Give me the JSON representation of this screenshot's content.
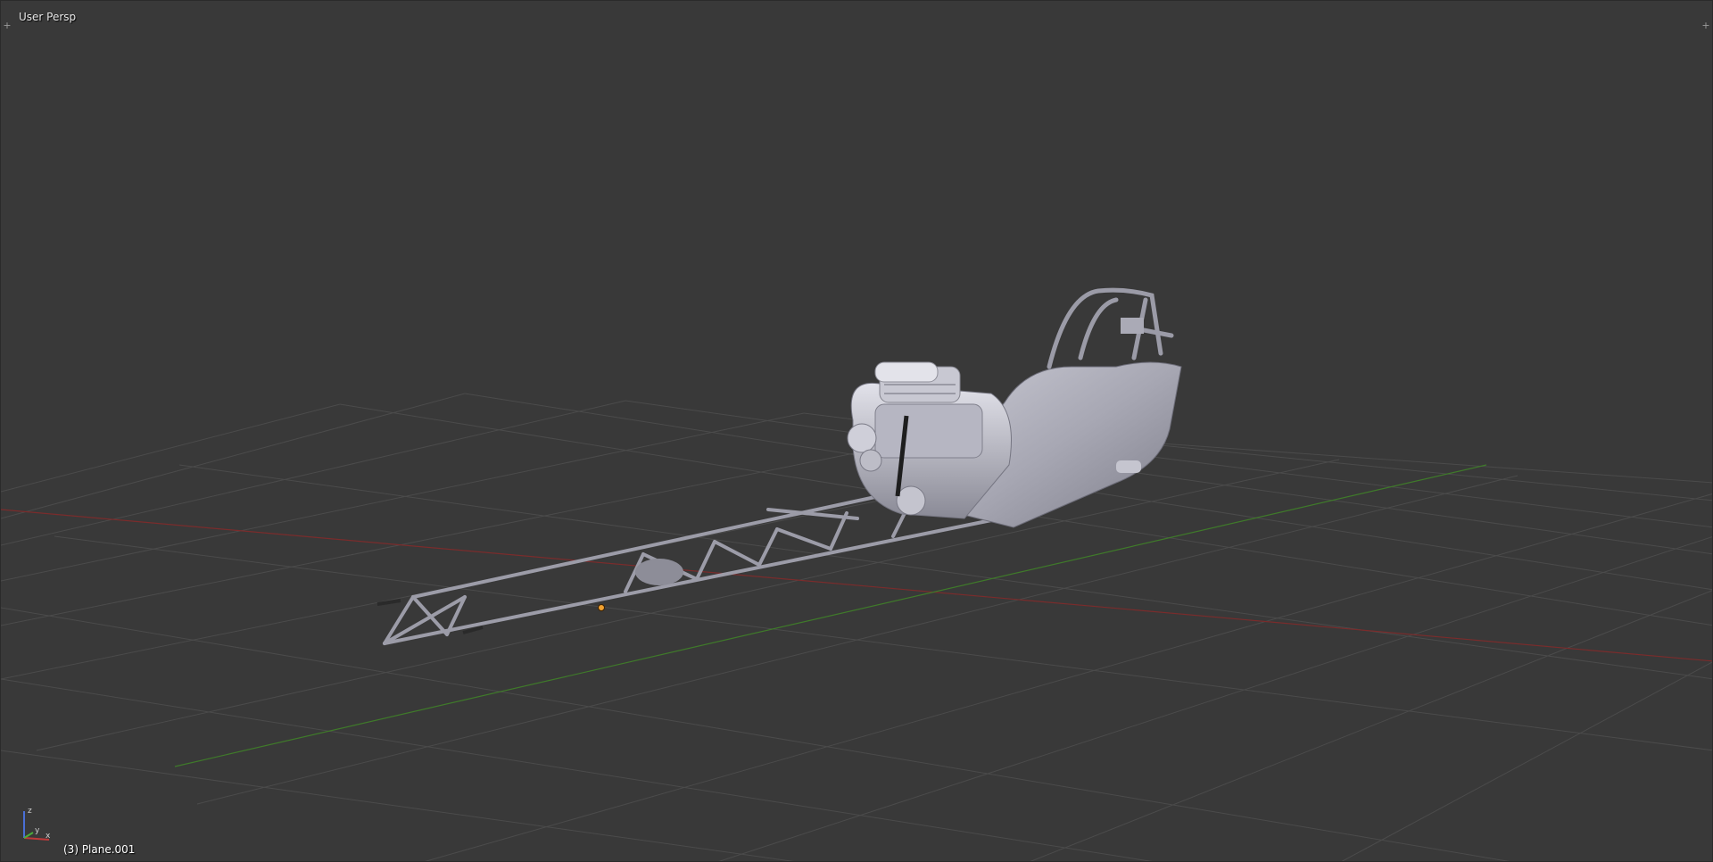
{
  "viewport": {
    "view_label": "User Persp",
    "object_info": "(3) Plane.001",
    "corner_left_icon": "plus-icon",
    "corner_right_icon": "plus-icon",
    "corner_glyph": "+",
    "axes": {
      "x": "x",
      "y": "y",
      "z": "z"
    }
  },
  "colors": {
    "background": "#393939",
    "grid": "#4a4a4a",
    "x_axis": "#8a2e2e",
    "y_axis": "#4e8a2e",
    "model": "#b9b9c4",
    "origin": "#f0a030"
  }
}
